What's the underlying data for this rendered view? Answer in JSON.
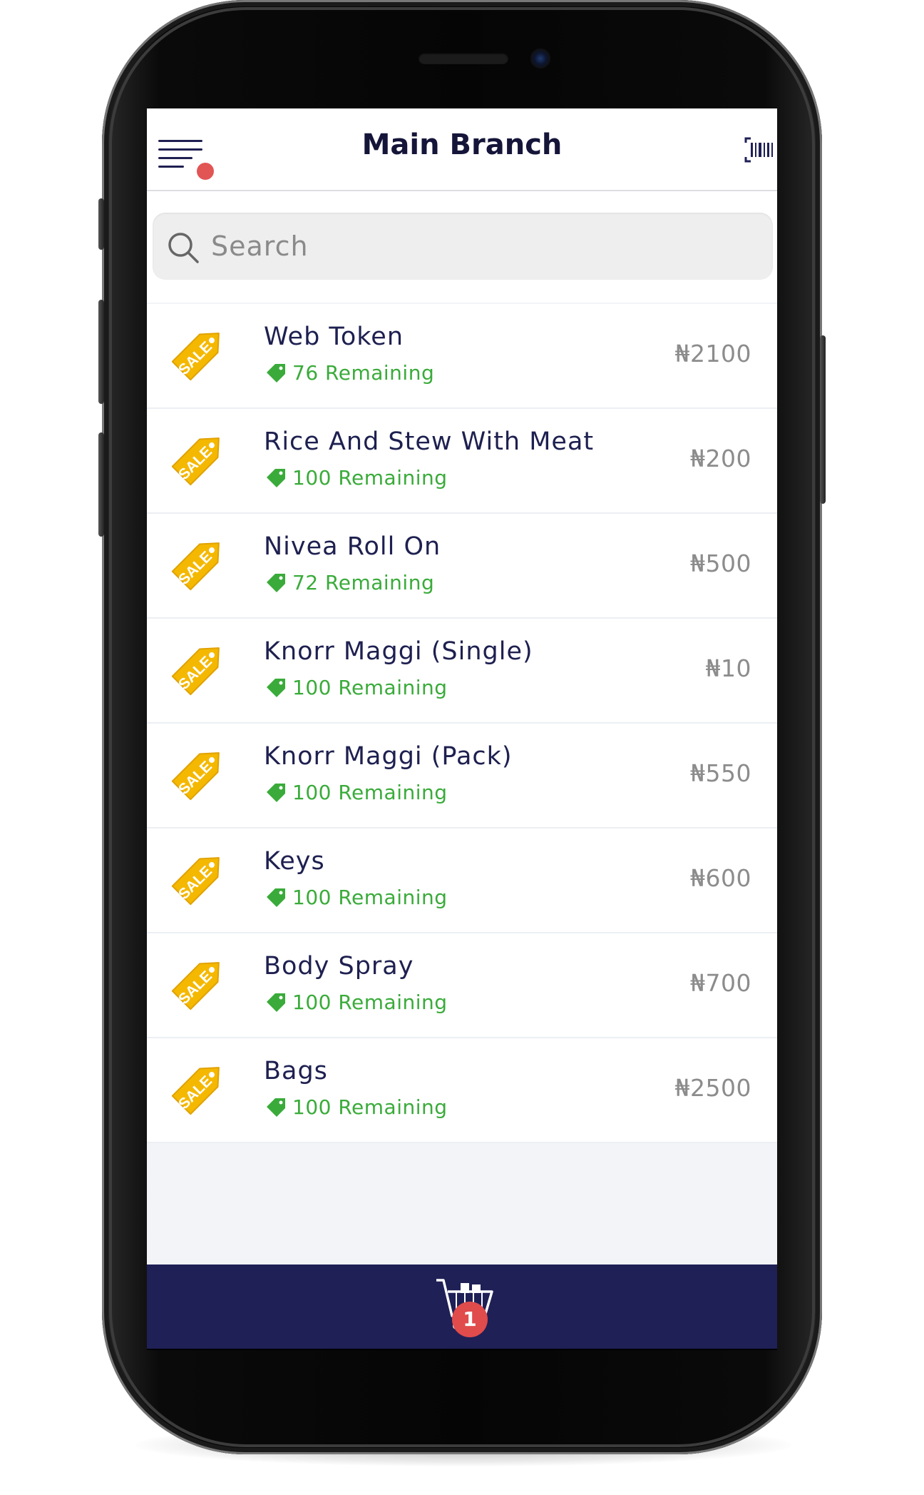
{
  "header": {
    "title": "Main Branch",
    "menu_icon": "hamburger-menu-icon",
    "notification_dot_color": "#e25555",
    "scanner_icon": "barcode-scanner-icon"
  },
  "search": {
    "placeholder": "Search",
    "icon": "search-icon"
  },
  "products": [
    {
      "name": "Web Token",
      "stock": "76 Remaining",
      "price": "₦2100"
    },
    {
      "name": "Rice And Stew With Meat",
      "stock": "100 Remaining",
      "price": "₦200"
    },
    {
      "name": "Nivea Roll On",
      "stock": "72 Remaining",
      "price": "₦500"
    },
    {
      "name": "Knorr Maggi (Single)",
      "stock": "100 Remaining",
      "price": "₦10"
    },
    {
      "name": "Knorr Maggi (Pack)",
      "stock": "100 Remaining",
      "price": "₦550"
    },
    {
      "name": "Keys",
      "stock": "100 Remaining",
      "price": "₦600"
    },
    {
      "name": "Body Spray",
      "stock": "100 Remaining",
      "price": "₦700"
    },
    {
      "name": "Bags",
      "stock": "100 Remaining",
      "price": "₦2500"
    }
  ],
  "sale_tag_text": "SALE",
  "cart": {
    "icon": "shopping-cart-icon",
    "badge_count": "1"
  },
  "colors": {
    "title": "#15153a",
    "stock_green": "#3aab3a",
    "price_gray": "#8c8c8c",
    "sale_yellow": "#f5b800",
    "cart_bar": "#1f2056",
    "badge_red": "#e04b4b"
  }
}
